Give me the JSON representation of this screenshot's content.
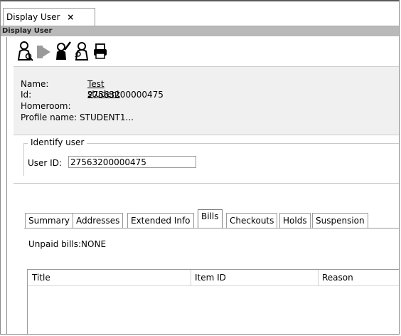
{
  "window_tab": {
    "title": "Display User",
    "close_glyph": "×"
  },
  "panel_header": "Display User",
  "toolbar": {
    "icons": [
      "user-search-icon",
      "forward-user-icon",
      "edit-user-icon",
      "user-lookup-icon",
      "print-icon"
    ]
  },
  "user_info": {
    "name_label": "Name:",
    "name_value": "Test student",
    "id_label": "Id:",
    "id_value": "27563200000475",
    "homeroom_label": "Homeroom:",
    "homeroom_value": "",
    "profile_label": "Profile name:",
    "profile_value": "STUDENT1..."
  },
  "identify": {
    "legend": "Identify user",
    "user_id_label": "User ID:",
    "user_id_value": "27563200000475"
  },
  "tabs": [
    {
      "label": "Summary"
    },
    {
      "label": "Addresses"
    },
    {
      "label": "Extended Info"
    },
    {
      "label": "Bills"
    },
    {
      "label": "Checkouts"
    },
    {
      "label": "Holds"
    },
    {
      "label": "Suspension"
    }
  ],
  "active_tab": "Bills",
  "bills": {
    "unpaid_text": "Unpaid bills:NONE",
    "columns": [
      "Title",
      "Item ID",
      "Reason"
    ]
  }
}
